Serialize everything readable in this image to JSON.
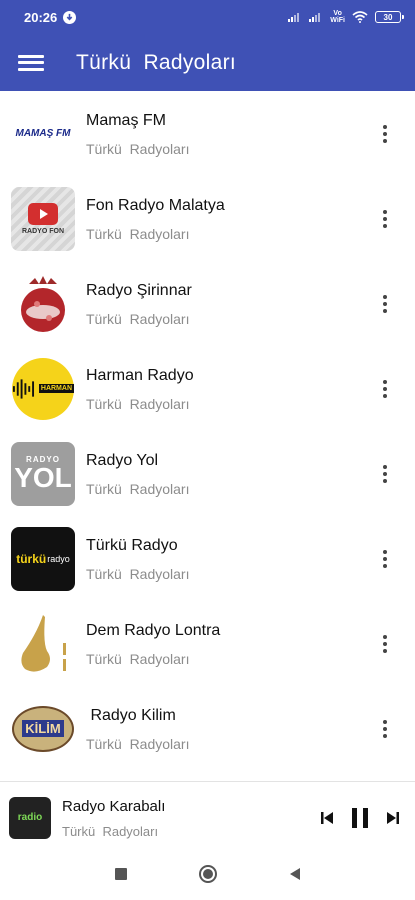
{
  "status_bar": {
    "time": "20:26",
    "network_top": "Vo",
    "network_bottom": "WiFi",
    "battery": "30"
  },
  "app_bar": {
    "title": "Türkü  Radyoları"
  },
  "stations": [
    {
      "name": "Mamaş FM",
      "category": "Türkü  Radyoları",
      "logo_text": "MAMAŞ FM"
    },
    {
      "name": "Fon Radyo Malatya",
      "category": "Türkü  Radyoları",
      "logo_text": "RADYO FON"
    },
    {
      "name": "Radyo Şirinnar",
      "category": "Türkü  Radyoları",
      "logo_text": ""
    },
    {
      "name": "Harman Radyo",
      "category": "Türkü  Radyoları",
      "logo_text": "HARMAN"
    },
    {
      "name": "Radyo Yol",
      "category": "Türkü  Radyoları",
      "logo_text": "YOL"
    },
    {
      "name": "Türkü Radyo",
      "category": "Türkü  Radyoları",
      "logo_text": "türkü"
    },
    {
      "name": "Dem Radyo Lontra",
      "category": "Türkü  Radyoları",
      "logo_text": ""
    },
    {
      "name": " Radyo Kilim",
      "category": "Türkü  Radyoları",
      "logo_text": "KİLİM"
    }
  ],
  "player": {
    "name": "Radyo Karabalı",
    "category": "Türkü  Radyoları",
    "logo_text": "radio"
  },
  "colors": {
    "primary": "#3f51b5",
    "text": "#111111",
    "subtext": "#8c8c8c"
  }
}
